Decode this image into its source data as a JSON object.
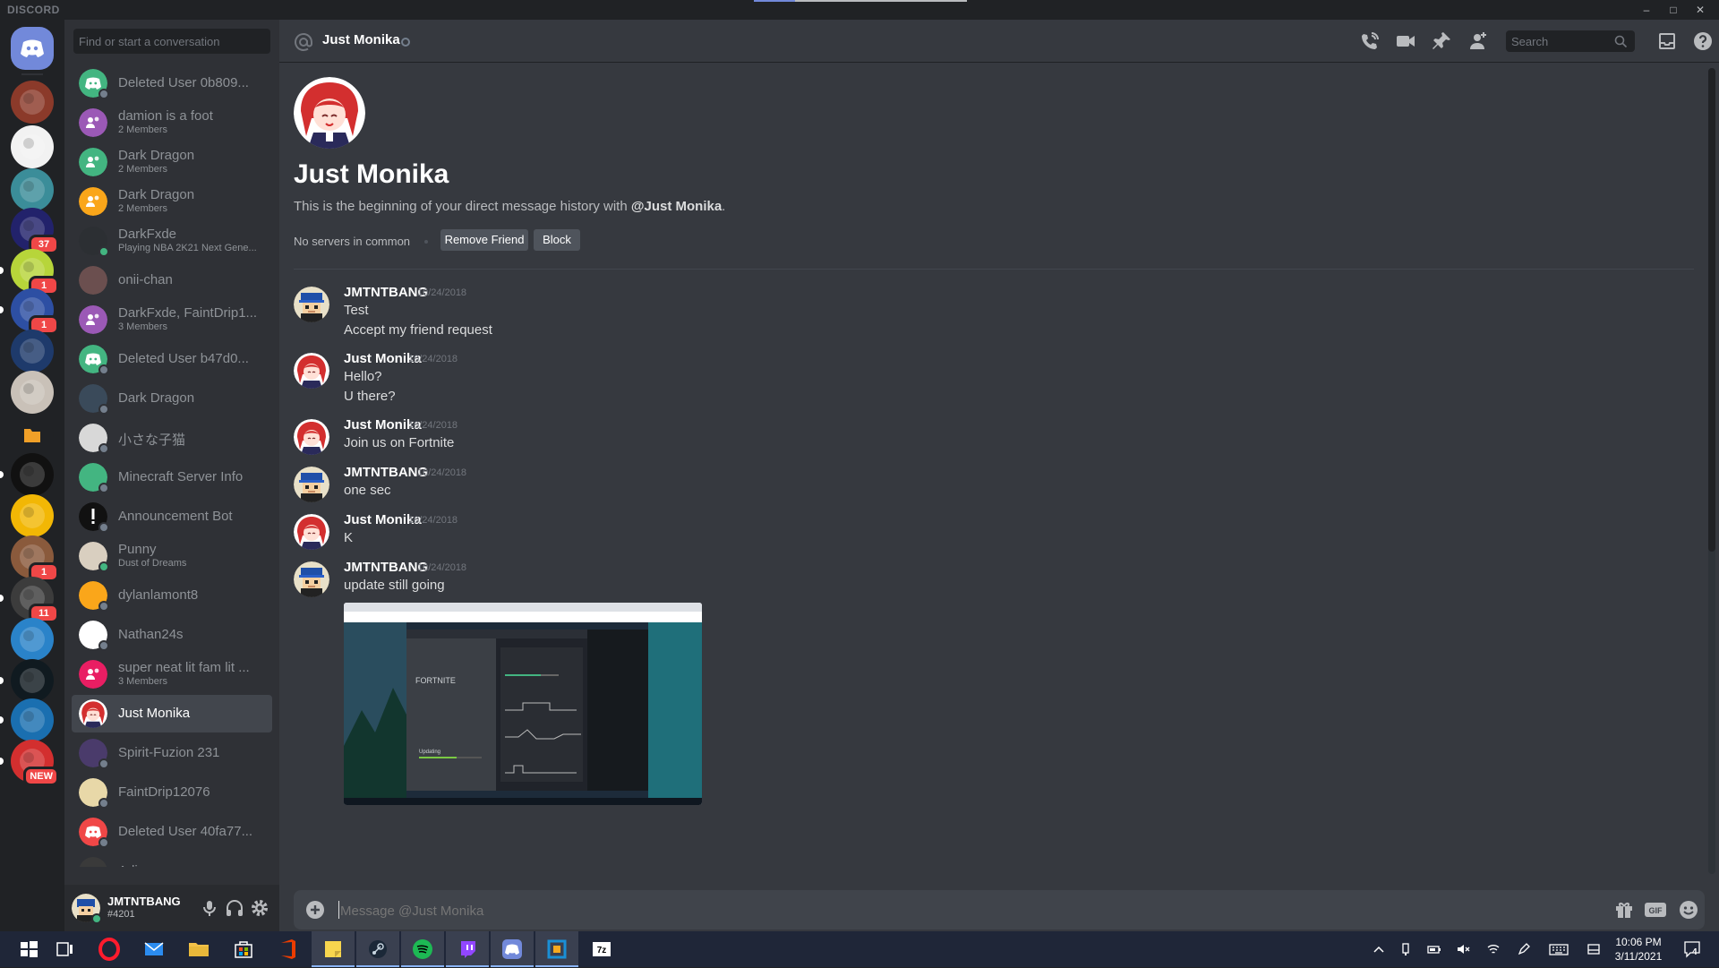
{
  "app": {
    "brand": "DISCORD"
  },
  "window_controls": [
    "–",
    "□",
    "✕"
  ],
  "guilds": [
    {
      "name": "home",
      "icon": "discord-logo-icon",
      "color": "#7289da",
      "badge": ""
    },
    {
      "name": "server-1",
      "icon": "server-icon",
      "color": "#8b3a2a",
      "badge": ""
    },
    {
      "name": "server-2",
      "icon": "server-icon",
      "color": "#f2f2f2",
      "badge": ""
    },
    {
      "name": "server-3",
      "icon": "server-icon",
      "color": "#3b8d99",
      "badge": ""
    },
    {
      "name": "server-4",
      "icon": "server-icon",
      "color": "#22226b",
      "badge": "37"
    },
    {
      "name": "server-5",
      "icon": "server-icon",
      "color": "#b7d53a",
      "badge": "1"
    },
    {
      "name": "server-6",
      "icon": "server-icon",
      "color": "#2d4fa3",
      "badge": "1"
    },
    {
      "name": "rocket-league",
      "icon": "server-icon",
      "color": "#1e3a6b",
      "badge": ""
    },
    {
      "name": "server-8",
      "icon": "server-icon",
      "color": "#c9c1b8",
      "badge": ""
    },
    {
      "name": "folder",
      "icon": "folder-icon",
      "color": "#202225",
      "badge": ""
    },
    {
      "name": "dunder-mifflin",
      "icon": "server-icon",
      "color": "#111111",
      "badge": ""
    },
    {
      "name": "sega-forever",
      "icon": "server-icon",
      "color": "#f2b705",
      "badge": ""
    },
    {
      "name": "parks-and-recreation",
      "icon": "server-icon",
      "color": "#8a5a3c",
      "badge": "1"
    },
    {
      "name": "server-14",
      "icon": "server-icon",
      "color": "#3c3c3c",
      "badge": "11"
    },
    {
      "name": "supreme-dudes",
      "icon": "server-icon",
      "color": "#2a83c9",
      "badge": ""
    },
    {
      "name": "sharkbyte",
      "icon": "server-icon",
      "color": "#101a20",
      "badge": ""
    },
    {
      "name": "emc",
      "icon": "server-icon",
      "color": "#1a6fb0",
      "badge": ""
    },
    {
      "name": "server-new",
      "icon": "server-icon",
      "color": "#d32f2f",
      "badge": "NEW"
    }
  ],
  "dm_search_placeholder": "Find or start a conversation",
  "dms": [
    {
      "name": "Deleted User 0b809...",
      "sub": "",
      "avatar_color": "#43b581",
      "status": "#747f8d",
      "selected": false
    },
    {
      "name": "damion is a foot",
      "sub": "2 Members",
      "avatar_color": "#9b59b6",
      "status": "",
      "selected": false
    },
    {
      "name": "Dark Dragon",
      "sub": "2 Members",
      "avatar_color": "#43b581",
      "status": "",
      "selected": false
    },
    {
      "name": "Dark Dragon",
      "sub": "2 Members",
      "avatar_color": "#faa61a",
      "status": "",
      "selected": false
    },
    {
      "name": "DarkFxde",
      "sub": "Playing NBA 2K21 Next Gene...",
      "avatar_color": "#2c2f33",
      "status": "#43b581",
      "selected": false
    },
    {
      "name": "onii-chan",
      "sub": "",
      "avatar_color": "#6b4f4f",
      "status": "",
      "selected": false
    },
    {
      "name": "DarkFxde, FaintDrip1...",
      "sub": "3 Members",
      "avatar_color": "#9b59b6",
      "status": "",
      "selected": false
    },
    {
      "name": "Deleted User b47d0...",
      "sub": "",
      "avatar_color": "#43b581",
      "status": "#747f8d",
      "selected": false
    },
    {
      "name": "Dark Dragon",
      "sub": "",
      "avatar_color": "#3a4a5a",
      "status": "#747f8d",
      "selected": false
    },
    {
      "name": "小さな子猫",
      "sub": "",
      "avatar_color": "#d8d8d8",
      "status": "#747f8d",
      "selected": false
    },
    {
      "name": "Minecraft Server Info",
      "sub": "",
      "avatar_color": "#43b581",
      "status": "#747f8d",
      "selected": false
    },
    {
      "name": "Announcement Bot",
      "sub": "",
      "avatar_color": "#111111",
      "status": "#747f8d",
      "selected": false
    },
    {
      "name": "Punny",
      "sub": "Dust of Dreams",
      "avatar_color": "#d9cfc0",
      "status": "#43b581",
      "selected": false
    },
    {
      "name": "dylanlamont8",
      "sub": "",
      "avatar_color": "#faa61a",
      "status": "#747f8d",
      "selected": false
    },
    {
      "name": "Nathan24s",
      "sub": "",
      "avatar_color": "#ffffff",
      "status": "#747f8d",
      "selected": false
    },
    {
      "name": "super neat lit fam lit ...",
      "sub": "3 Members",
      "avatar_color": "#e91e63",
      "status": "",
      "selected": false
    },
    {
      "name": "Just Monika",
      "sub": "",
      "avatar_color": "#d32f2f",
      "status": "",
      "selected": true
    },
    {
      "name": "Spirit-Fuzion 231",
      "sub": "",
      "avatar_color": "#4a3b6b",
      "status": "#747f8d",
      "selected": false
    },
    {
      "name": "FaintDrip12076",
      "sub": "",
      "avatar_color": "#e8d8a8",
      "status": "#747f8d",
      "selected": false
    },
    {
      "name": "Deleted User 40fa77...",
      "sub": "",
      "avatar_color": "#f04747",
      "status": "#747f8d",
      "selected": false
    },
    {
      "name": "Adin",
      "sub": "",
      "avatar_color": "#3a3a3a",
      "status": "#747f8d",
      "selected": false
    }
  ],
  "user": {
    "name": "JMTNTBANG",
    "tag": "#4201",
    "status_color": "#43b581"
  },
  "header": {
    "title": "Just Monika",
    "search_placeholder": "Search"
  },
  "intro": {
    "name": "Just Monika",
    "beginning_prefix": "This is the beginning of your direct message history with ",
    "beginning_handle": "@Just Monika",
    "beginning_suffix": ".",
    "no_common": "No servers in common",
    "remove_friend": "Remove Friend",
    "block": "Block"
  },
  "messages": [
    {
      "author": "JMTNTBANG",
      "time": "10/24/2018",
      "avatar": "jmt",
      "lines": [
        "Test",
        "Accept my friend request"
      ],
      "attachment": false
    },
    {
      "author": "Just Monika",
      "time": "10/24/2018",
      "avatar": "monika",
      "lines": [
        "Hello?",
        "U there?"
      ],
      "attachment": false
    },
    {
      "author": "Just Monika",
      "time": "10/24/2018",
      "avatar": "monika",
      "lines": [
        "Join us on Fortnite"
      ],
      "attachment": false
    },
    {
      "author": "JMTNTBANG",
      "time": "10/24/2018",
      "avatar": "jmt",
      "lines": [
        "one sec"
      ],
      "attachment": false
    },
    {
      "author": "Just Monika",
      "time": "10/24/2018",
      "avatar": "monika",
      "lines": [
        "K"
      ],
      "attachment": false
    },
    {
      "author": "JMTNTBANG",
      "time": "10/24/2018",
      "avatar": "jmt",
      "lines": [
        "update still going"
      ],
      "attachment": true
    }
  ],
  "attachment": {
    "title": "FORTNITE",
    "status": "Updating"
  },
  "composer": {
    "placeholder": "Message @Just Monika"
  },
  "taskbar": {
    "apps": [
      "windows-start",
      "task-view",
      "opera",
      "mail",
      "file-explorer",
      "store",
      "office",
      "sticky-notes",
      "steam",
      "spotify",
      "twitch",
      "discord",
      "virtualbox",
      "7zip"
    ],
    "time": "10:06 PM",
    "date": "3/11/2021",
    "notifications": "4"
  }
}
